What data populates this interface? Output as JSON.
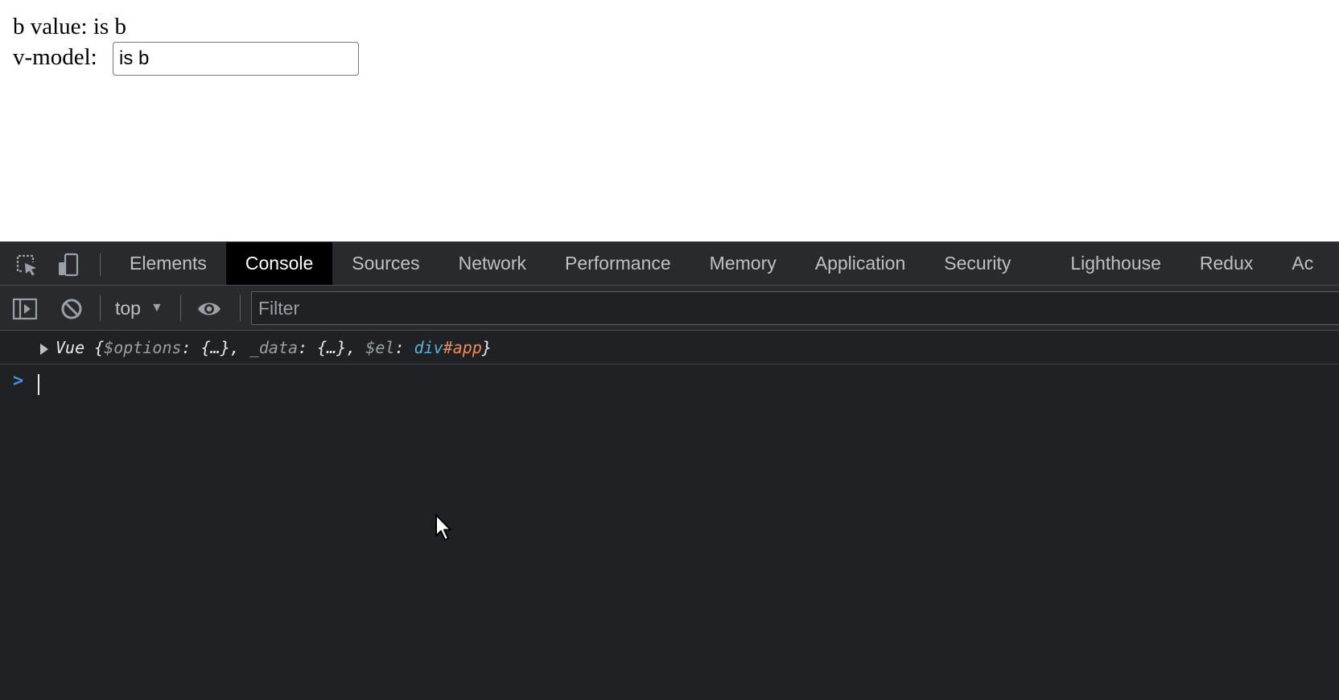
{
  "page": {
    "b_value_line": "b value: is b",
    "vmodel_label": "v-model:",
    "vmodel_value": "is b"
  },
  "devtools": {
    "tabs": [
      {
        "label": "Elements"
      },
      {
        "label": "Console"
      },
      {
        "label": "Sources"
      },
      {
        "label": "Network"
      },
      {
        "label": "Performance"
      },
      {
        "label": "Memory"
      },
      {
        "label": "Application"
      },
      {
        "label": "Security"
      },
      {
        "label": "Lighthouse"
      },
      {
        "label": "Redux"
      },
      {
        "label": "Ac"
      }
    ],
    "active_tab": "Console",
    "icons": {
      "inspect": "inspect-element-icon",
      "device": "device-toolbar-icon",
      "sidebar": "console-sidebar-icon",
      "clear": "clear-console-icon",
      "eye": "live-expression-eye-icon",
      "dropdown": "dropdown-caret-icon",
      "expand": "expand-triangle-icon",
      "prompt": "prompt-chevron-icon"
    },
    "toolbar": {
      "context": "top",
      "filter_placeholder": "Filter"
    },
    "console": {
      "log_parts": {
        "class_name": "Vue ",
        "open": "{",
        "k1": "$options",
        "v1": ": {…}, ",
        "k2": "_data",
        "v2": ": {…}, ",
        "k3": "$el",
        "colon": ": ",
        "tag": "div",
        "id": "#app",
        "close": "}"
      },
      "prompt_symbol": ">"
    },
    "colors": {
      "panel_bg": "#202124",
      "toolbar_bg": "#292a2d",
      "active_tab_bg": "#000000",
      "tag_color": "#5db0d7",
      "id_color": "#f28b54",
      "prompt_color": "#4d8fe8"
    }
  }
}
